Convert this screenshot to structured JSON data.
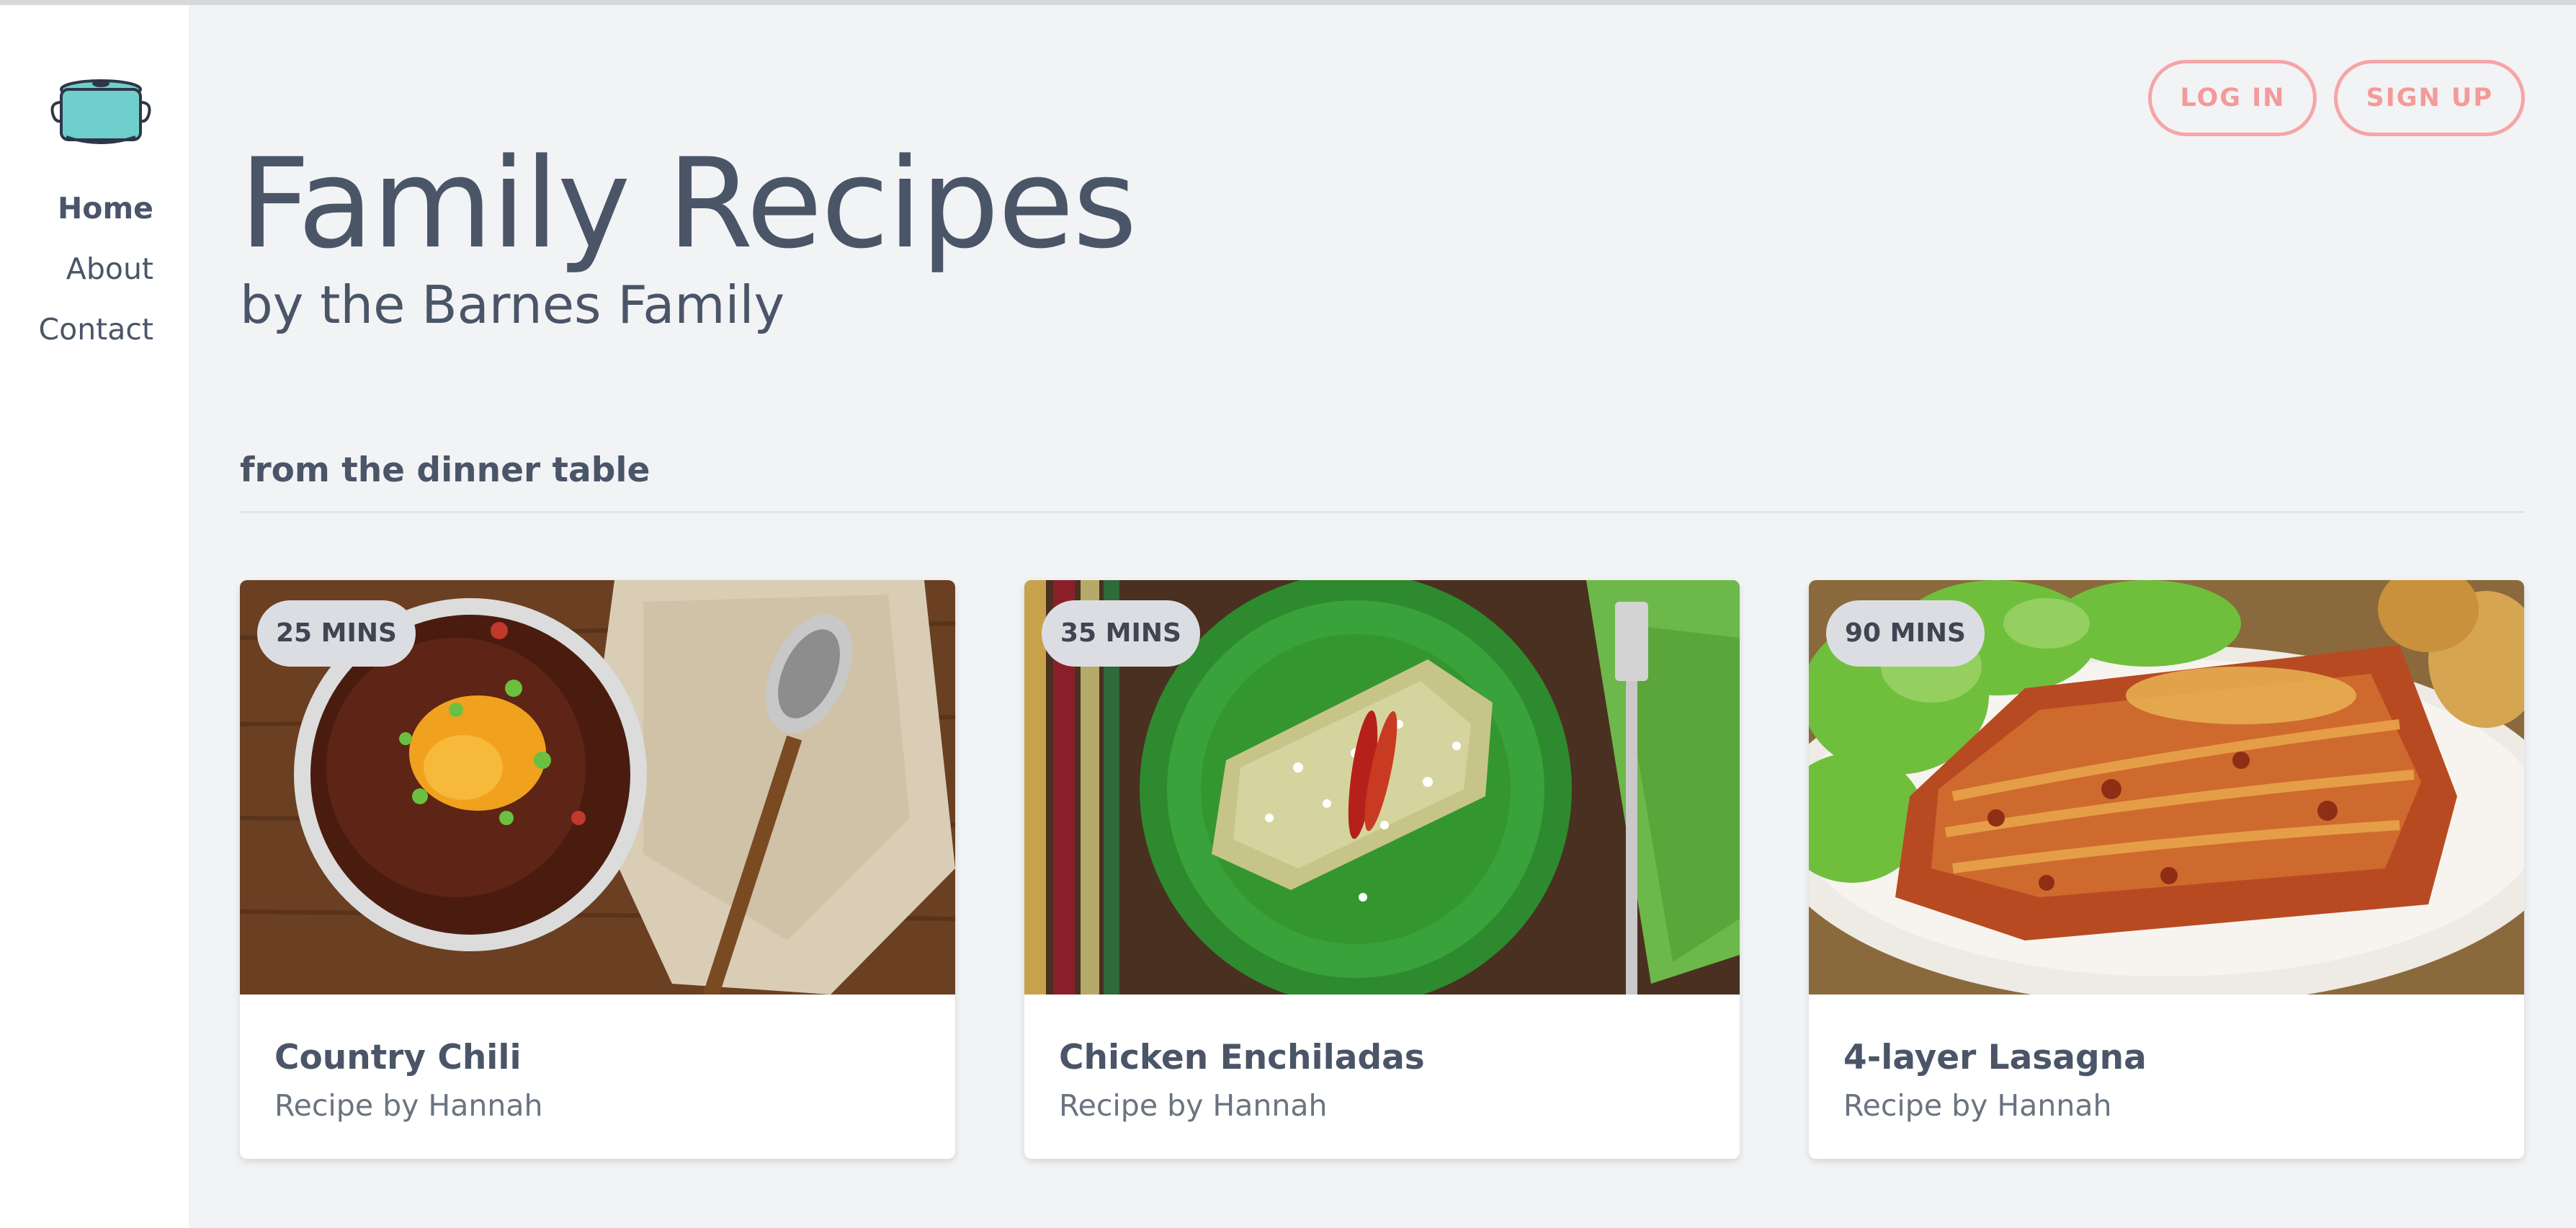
{
  "sidebar": {
    "logo_icon": "cooking-pot-icon",
    "nav": [
      {
        "label": "Home",
        "active": true
      },
      {
        "label": "About",
        "active": false
      },
      {
        "label": "Contact",
        "active": false
      }
    ]
  },
  "header": {
    "login_label": "LOG IN",
    "signup_label": "SIGN UP",
    "title": "Family Recipes",
    "subtitle": "by the Barnes Family"
  },
  "section": {
    "heading": "from the dinner table"
  },
  "recipes": [
    {
      "time": "25 MINS",
      "title": "Country Chili",
      "author": "Recipe by Hannah",
      "image": "bowl of chili with cheese and scallions"
    },
    {
      "time": "35 MINS",
      "title": "Chicken Enchiladas",
      "author": "Recipe by Hannah",
      "image": "enchiladas on green plate"
    },
    {
      "time": "90 MINS",
      "title": "4-layer Lasagna",
      "author": "Recipe by Hannah",
      "image": "lasagna with salad on white plate"
    }
  ],
  "colors": {
    "accent_pink": "#f6a5a5",
    "logo_teal": "#6fcfcc",
    "text": "#4a5568",
    "background": "#f2f3f5"
  }
}
